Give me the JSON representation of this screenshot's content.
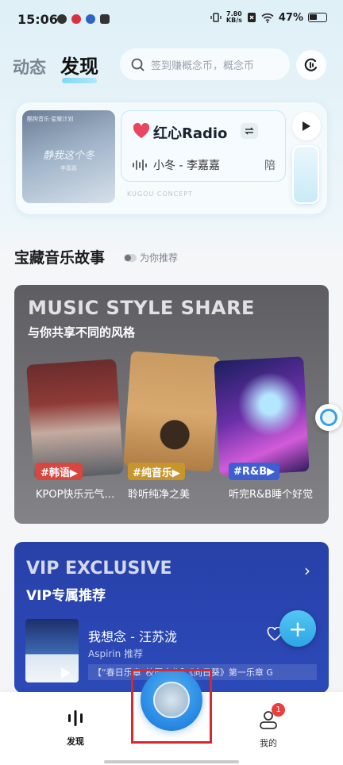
{
  "status_bar": {
    "time": "15:06",
    "net_speed_value": "7.80",
    "net_speed_unit": "KB/s",
    "battery": "47%"
  },
  "header": {
    "tab_dynamic": "动态",
    "tab_discover": "发现",
    "search_placeholder": "签到赚概念币，概念币"
  },
  "radio": {
    "album_brand": "酷狗音乐·星耀计划",
    "album_title": "静我这个冬",
    "album_sub": "李嘉嘉",
    "title": "红心Radio",
    "song": "小冬 - 李嘉嘉",
    "next_char": "陪",
    "concept_label": "KUGOU CONCEPT"
  },
  "section": {
    "title": "宝藏音乐故事",
    "tag": "为你推荐"
  },
  "style_share": {
    "title": "MUSIC STYLE SHARE",
    "subtitle": "与你共享不同的风格",
    "items": [
      {
        "tag": "#韩语▶",
        "caption": "KPOP快乐元气…"
      },
      {
        "tag": "#纯音乐▶",
        "caption": "聆听纯净之美"
      },
      {
        "tag": "#R&B▶",
        "caption": "听完R&B睡个好觉"
      }
    ]
  },
  "vip": {
    "title": "VIP EXCLUSIVE",
    "subtitle": "VIP专属推荐",
    "song": "我想念 - 汪苏泷",
    "recommend": "Aspirin 推荐",
    "desc": "【“春日乐章”校园合集】《向日葵》第一乐章  G"
  },
  "bottom_nav": {
    "discover_label": "发现",
    "me_label": "我的",
    "me_badge": "1"
  },
  "colors": {
    "accent": "#2ea6e6",
    "vip_blue": "#2a46b3",
    "badge_red": "#ec3d3d",
    "highlight_red": "#d9272e"
  }
}
